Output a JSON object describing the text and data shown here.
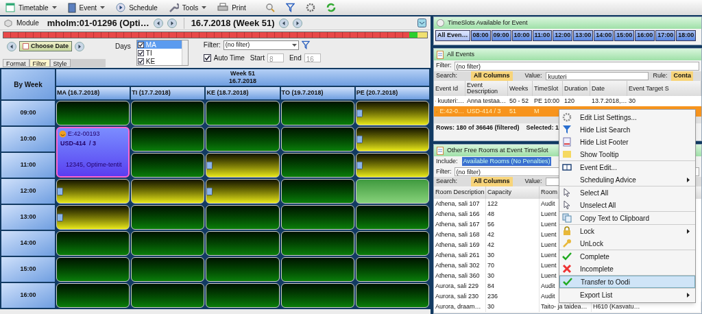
{
  "toolbar": [
    {
      "label": "Timetable",
      "caret": true
    },
    {
      "label": "Event",
      "caret": true
    },
    {
      "label": "Schedule",
      "caret": false
    },
    {
      "label": "Tools",
      "caret": true
    },
    {
      "label": "Print",
      "caret": false
    }
  ],
  "module": {
    "label": "Module",
    "name": "mholm:01-01296 (Opti…",
    "date": "16.7.2018 (Week 51)"
  },
  "controls": {
    "choose_date": "Choose Date",
    "days_label": "Days",
    "days": [
      {
        "label": "MA",
        "checked": true,
        "selected": true
      },
      {
        "label": "TI",
        "checked": true,
        "selected": false
      },
      {
        "label": "KE",
        "checked": true,
        "selected": false
      }
    ],
    "filter_label": "Filter:",
    "filter_value": "(no filter)",
    "auto_time": {
      "label": "Auto Time",
      "checked": true
    },
    "start_label": "Start",
    "start_value": "8",
    "end_label": "End",
    "end_value": "16",
    "tabs": [
      {
        "label": "Format",
        "selected": false
      },
      {
        "label": "Filter",
        "selected": true
      },
      {
        "label": "Style",
        "selected": false
      }
    ]
  },
  "grid": {
    "corner": "By Week",
    "week_title": "Week 51",
    "week_date": "16.7.2018",
    "days": [
      "MA (16.7.2018)",
      "TI (17.7.2018)",
      "KE (18.7.2018)",
      "TO (19.7.2018)",
      "PE (20.7.2018)"
    ],
    "rows": [
      {
        "time": "09:00",
        "cells": [
          {
            "kind": "free",
            "marked": false
          },
          {
            "kind": "free",
            "marked": false
          },
          {
            "kind": "free",
            "marked": false
          },
          {
            "kind": "free",
            "marked": false
          },
          {
            "kind": "partial",
            "marked": true
          }
        ]
      },
      {
        "time": "10:00",
        "cells": [
          {
            "kind": "event",
            "id": "E:42-00193",
            "title": "USD-414  / 3",
            "info": "12345, Optime-tentit"
          },
          {
            "kind": "free",
            "marked": false
          },
          {
            "kind": "free",
            "marked": false
          },
          {
            "kind": "free",
            "marked": false
          },
          {
            "kind": "partial",
            "marked": true
          }
        ]
      },
      {
        "time": "11:00",
        "cells": [
          {
            "kind": "covered"
          },
          {
            "kind": "free",
            "marked": false
          },
          {
            "kind": "partial",
            "marked": true
          },
          {
            "kind": "free",
            "marked": false
          },
          {
            "kind": "partial",
            "marked": true
          }
        ]
      },
      {
        "time": "12:00",
        "cells": [
          {
            "kind": "partial",
            "marked": true
          },
          {
            "kind": "partial",
            "marked": false
          },
          {
            "kind": "partial",
            "marked": true
          },
          {
            "kind": "free",
            "marked": false
          },
          {
            "kind": "best",
            "marked": false
          }
        ]
      },
      {
        "time": "13:00",
        "cells": [
          {
            "kind": "partial",
            "marked": true
          },
          {
            "kind": "free",
            "marked": false
          },
          {
            "kind": "free",
            "marked": false
          },
          {
            "kind": "free",
            "marked": false
          },
          {
            "kind": "free",
            "marked": false
          }
        ]
      },
      {
        "time": "14:00",
        "cells": [
          {
            "kind": "free",
            "marked": false
          },
          {
            "kind": "free",
            "marked": false
          },
          {
            "kind": "free",
            "marked": false
          },
          {
            "kind": "free",
            "marked": false
          },
          {
            "kind": "free",
            "marked": false
          }
        ]
      },
      {
        "time": "15:00",
        "cells": [
          {
            "kind": "free",
            "marked": false
          },
          {
            "kind": "free",
            "marked": false
          },
          {
            "kind": "free",
            "marked": false
          },
          {
            "kind": "free",
            "marked": false
          },
          {
            "kind": "free",
            "marked": false
          }
        ]
      },
      {
        "time": "16:00",
        "cells": [
          {
            "kind": "free",
            "marked": false
          },
          {
            "kind": "free",
            "marked": false
          },
          {
            "kind": "free",
            "marked": false
          },
          {
            "kind": "free",
            "marked": false
          },
          {
            "kind": "free",
            "marked": false
          }
        ]
      }
    ]
  },
  "timeslots": {
    "title": "TimeSlots Available for Event",
    "slots": [
      {
        "label": "All Even…",
        "selected": true
      },
      {
        "label": "08:00",
        "selected": false
      },
      {
        "label": "09:00",
        "selected": false
      },
      {
        "label": "10:00",
        "selected": false
      },
      {
        "label": "11:00",
        "selected": false
      },
      {
        "label": "12:00",
        "selected": false
      },
      {
        "label": "13:00",
        "selected": false
      },
      {
        "label": "14:00",
        "selected": false
      },
      {
        "label": "15:00",
        "selected": false
      },
      {
        "label": "16:00",
        "selected": false
      },
      {
        "label": "17:00",
        "selected": false
      },
      {
        "label": "18:00",
        "selected": false
      }
    ]
  },
  "all_events": {
    "title": "All Events",
    "filter_label": "Filter:",
    "filter_value": "(no filter)",
    "search_label": "Search:",
    "search_column": "All Columns",
    "value_label": "Value:",
    "value": "kuuteri",
    "rule_label": "Rule:",
    "rule_value": "Conta",
    "columns": [
      "Event Id",
      "Event Description",
      "Weeks",
      "TimeSlot",
      "Duration",
      "Date",
      "Event Target S"
    ],
    "rows": [
      {
        "selected": false,
        "cells": [
          "kuuteri:…",
          "Anna testaa…",
          "50 - 52",
          "PE 10:00",
          "120",
          "13.7.2018,…",
          "30"
        ]
      },
      {
        "selected": true,
        "cells": [
          "E:42-0…",
          "USD-414 / 3",
          "51",
          "M",
          "",
          "",
          ""
        ]
      }
    ],
    "footer_rows": "Rows: 180 of 36646 (filtered)",
    "footer_selected": "Selected: 1"
  },
  "free_rooms": {
    "title": "Other Free Rooms at Event TimeSlot",
    "include_label": "Include:",
    "include_value": "Available Rooms (No Penalties)",
    "filter_label": "Filter:",
    "filter_value": "(no filter)",
    "search_label": "Search:",
    "search_column": "All Columns",
    "value_label": "Value:",
    "columns": [
      "Room Description",
      "Capacity",
      "Room"
    ],
    "rows": [
      [
        "Athena, sali 107",
        "122",
        "Audit"
      ],
      [
        "Athena, sali 166",
        "48",
        "Luent"
      ],
      [
        "Athena, sali 167",
        "56",
        "Luent"
      ],
      [
        "Athena, sali 168",
        "42",
        "Luent"
      ],
      [
        "Athena, sali 169",
        "42",
        "Luent"
      ],
      [
        "Athena, sali 261",
        "30",
        "Luent"
      ],
      [
        "Athena, sali 302",
        "70",
        "Luent"
      ],
      [
        "Athena, sali 360",
        "30",
        "Luent"
      ],
      [
        "Aurora, sali 229",
        "84",
        "Audit"
      ],
      [
        "Aurora, sali 230",
        "236",
        "Audit"
      ],
      [
        "Aurora, draam…",
        "30",
        "Taito- ja taidea…",
        "H610 (Kasvatu…"
      ]
    ]
  },
  "context_menu": {
    "groups": [
      [
        {
          "label": "Edit List Settings...",
          "kind": "gear",
          "submenu": false,
          "highlighted": false
        },
        {
          "label": "Hide List Search",
          "kind": "filter",
          "submenu": false,
          "highlighted": false
        },
        {
          "label": "Hide List Footer",
          "kind": "page",
          "submenu": false,
          "highlighted": false
        },
        {
          "label": "Show Tooltip",
          "kind": "note",
          "submenu": false,
          "highlighted": false
        }
      ],
      [
        {
          "label": "Event Edit...",
          "kind": "book",
          "submenu": false,
          "highlighted": false
        },
        {
          "label": "Scheduling Advice",
          "kind": "plain",
          "submenu": true,
          "highlighted": false
        }
      ],
      [
        {
          "label": "Select All",
          "kind": "cursor",
          "submenu": false,
          "highlighted": false
        },
        {
          "label": "Unselect All",
          "kind": "cursor",
          "submenu": false,
          "highlighted": false
        }
      ],
      [
        {
          "label": "Copy Text to Clipboard",
          "kind": "copy",
          "submenu": false,
          "highlighted": false
        }
      ],
      [
        {
          "label": "Lock",
          "kind": "lock",
          "submenu": true,
          "highlighted": false
        },
        {
          "label": "UnLock",
          "kind": "key",
          "submenu": false,
          "highlighted": false
        }
      ],
      [
        {
          "label": "Complete",
          "kind": "check",
          "submenu": false,
          "highlighted": false
        },
        {
          "label": "Incomplete",
          "kind": "cross",
          "submenu": false,
          "highlighted": false
        }
      ],
      [
        {
          "label": "Transfer to Oodi",
          "kind": "check",
          "submenu": false,
          "highlighted": true
        }
      ],
      [
        {
          "label": "Export List",
          "kind": "plain",
          "submenu": true,
          "highlighted": false
        }
      ]
    ]
  }
}
